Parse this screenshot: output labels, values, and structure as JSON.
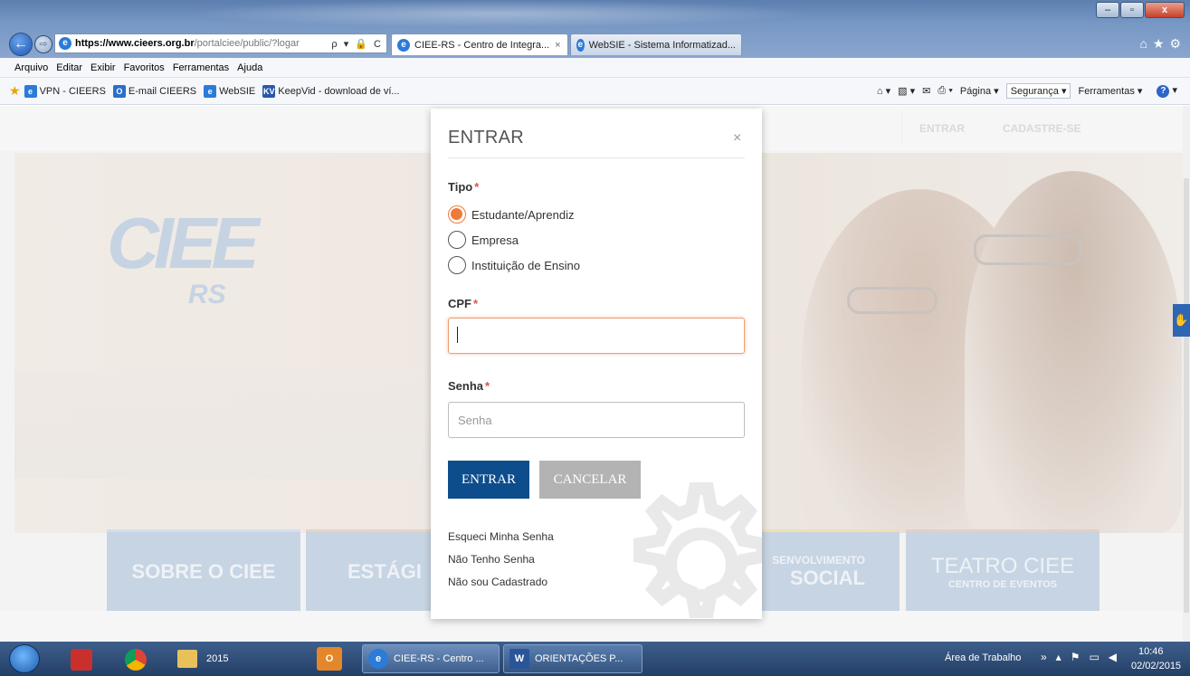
{
  "browser": {
    "address_url_bold": "https://www.cieers.org.br",
    "address_url_rest": "/portalciee/public/?logar",
    "address_tools": "ρ ▾ 🔒 C",
    "tabs": [
      {
        "label": "CIEE-RS - Centro de Integra...",
        "close": "×"
      },
      {
        "label": "WebSIE - Sistema Informatizad..."
      }
    ],
    "menu": [
      "Arquivo",
      "Editar",
      "Exibir",
      "Favoritos",
      "Ferramentas",
      "Ajuda"
    ],
    "favorites": [
      {
        "label": "VPN - CIEERS",
        "icon": "ie-icon",
        "color": "#2b7bd8"
      },
      {
        "label": "E-mail CIEERS",
        "icon": "outlook-icon",
        "color": "#2a6fc9"
      },
      {
        "label": "WebSIE",
        "icon": "ie-icon",
        "color": "#2b7bd8"
      },
      {
        "label": "KeepVid - download de ví...",
        "icon": "keepvid-icon",
        "color": "#2a58a8"
      }
    ],
    "commands": {
      "pagina": "Página ▾",
      "seguranca": "Segurança ▾",
      "ferramentas": "Ferramentas ▾"
    }
  },
  "page": {
    "header": {
      "entrar": "ENTRAR",
      "cadastre": "CADASTRE-SE"
    },
    "logo": {
      "mark": "CIEE",
      "region": "RS"
    },
    "tiles": {
      "sobre": "SOBRE O CIEE",
      "estagio": "ESTÁGI",
      "social_top": "SENVOLVIMENTO",
      "social_bottom": "SOCIAL",
      "teatro_top": "TEATRO CIEE",
      "teatro_bottom": "CENTRO DE EVENTOS"
    }
  },
  "modal": {
    "title": "ENTRAR",
    "close": "×",
    "tipo_label": "Tipo",
    "required_mark": "*",
    "tipo_options": [
      {
        "label": "Estudante/Aprendiz",
        "selected": true
      },
      {
        "label": "Empresa",
        "selected": false
      },
      {
        "label": "Instituição de Ensino",
        "selected": false
      }
    ],
    "cpf_label": "CPF",
    "cpf_value": "",
    "senha_label": "Senha",
    "senha_placeholder": "Senha",
    "btn_entrar": "ENTRAR",
    "btn_cancelar": "CANCELAR",
    "links": [
      "Esqueci Minha Senha",
      "Não Tenho Senha",
      "Não sou Cadastrado"
    ]
  },
  "taskbar": {
    "items": [
      {
        "label": "2015"
      },
      {
        "label": "CIEE-RS - Centro ..."
      },
      {
        "label": "ORIENTAÇÕES P..."
      }
    ],
    "desktop_label": "Área de Trabalho",
    "time": "10:46",
    "date": "02/02/2015"
  },
  "colors": {
    "primary": "#0d4d8c",
    "accent": "#ee7b3a",
    "cancel": "#b3b3b3",
    "required": "#d9534f"
  }
}
